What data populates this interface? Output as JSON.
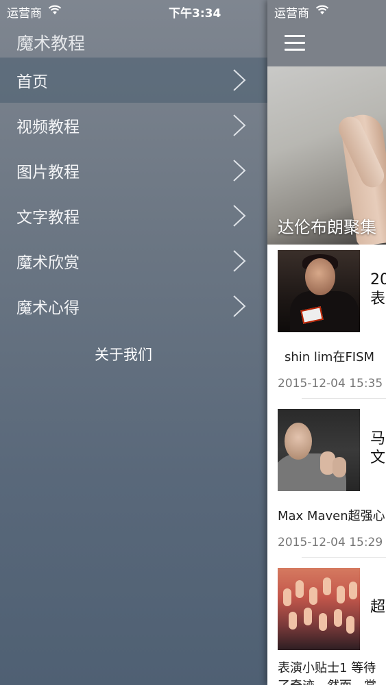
{
  "status_left": {
    "carrier": "运营商",
    "time": "下午3:34"
  },
  "status_right": {
    "carrier": "运营商"
  },
  "drawer": {
    "title": "魔术教程",
    "items": [
      {
        "label": "首页",
        "active": true
      },
      {
        "label": "视频教程",
        "active": false
      },
      {
        "label": "图片教程",
        "active": false
      },
      {
        "label": "文字教程",
        "active": false
      },
      {
        "label": "魔术欣赏",
        "active": false
      },
      {
        "label": "魔术心得",
        "active": false
      }
    ],
    "about": "关于我们"
  },
  "main": {
    "banner_title": "达伦布朗聚集",
    "articles": [
      {
        "title_line1": "20",
        "title_line2": "表",
        "summary": "shin lim在FISM",
        "date": "2015-12-04 15:35"
      },
      {
        "title_line1": "马",
        "title_line2": "文",
        "summary": "Max Maven超强心",
        "date": "2015-12-04 15:29"
      },
      {
        "title_line1": "超",
        "title_line2": "",
        "summary": "表演小贴士1 等待",
        "summary_line2": "了奇迹。然而，掌",
        "date": ""
      }
    ]
  },
  "colors": {
    "drawer_top": "#7f8690",
    "drawer_bottom": "#4f6073",
    "active_row": "#4f6478",
    "nav_bar": "#7c8189"
  }
}
